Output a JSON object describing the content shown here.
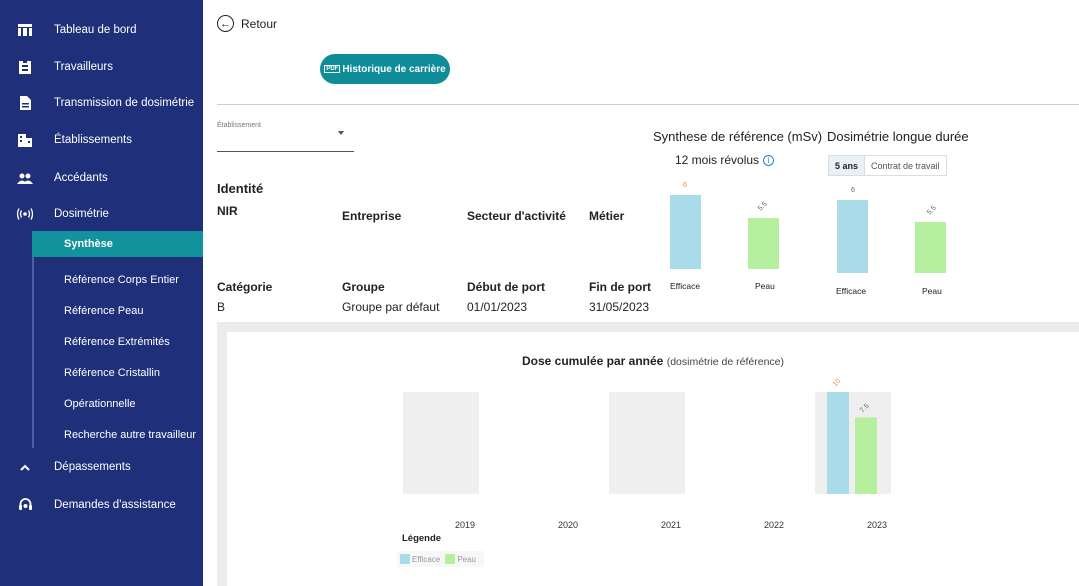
{
  "sidebar": {
    "items": [
      {
        "label": "Tableau de bord",
        "icon": "dashboard-icon"
      },
      {
        "label": "Travailleurs",
        "icon": "badge-icon"
      },
      {
        "label": "Transmission de dosimétrie",
        "icon": "document-icon"
      },
      {
        "label": "Établissements",
        "icon": "building-icon"
      },
      {
        "label": "Accédants",
        "icon": "people-icon"
      },
      {
        "label": "Dosimétrie",
        "icon": "radiation-icon"
      },
      {
        "label": "Dépassements",
        "icon": "chevron-up-icon"
      },
      {
        "label": "Demandes d'assistance",
        "icon": "support-icon"
      }
    ],
    "subitems": [
      {
        "label": "Synthèse",
        "active": true
      },
      {
        "label": "Référence Corps Entier"
      },
      {
        "label": "Référence Peau"
      },
      {
        "label": "Référence Extrémités"
      },
      {
        "label": "Référence Cristallin"
      },
      {
        "label": "Opérationnelle"
      },
      {
        "label": "Recherche autre travailleur"
      }
    ]
  },
  "header": {
    "back_label": "Retour",
    "history_button": "Historique de carrière",
    "pdf_badge": "PDF"
  },
  "establishment_select": {
    "placeholder": "Établissement"
  },
  "identity": {
    "title": "Identité",
    "row1_labels": [
      "NIR",
      "Entreprise",
      "Secteur d'activité",
      "Métier"
    ],
    "row2_labels": [
      "Catégorie",
      "Groupe",
      "Début de port",
      "Fin de port"
    ],
    "row2_values": [
      "B",
      "Groupe par défaut",
      "01/01/2023",
      "31/05/2023"
    ]
  },
  "reference_synthesis": {
    "title": "Synthese de référence (mSv)",
    "subtitle": "12 mois révolus",
    "bars": [
      {
        "label": "Efficace",
        "value_label": "6",
        "value": 6,
        "color": "#a9dce8"
      },
      {
        "label": "Peau",
        "value_label": "5.5",
        "value": 5.5,
        "color": "#b6ef9e"
      }
    ]
  },
  "long_term": {
    "title": "Dosimétrie longue durée",
    "toggle": [
      "5 ans",
      "Contrat de travail"
    ],
    "toggle_active": "5 ans",
    "bars": [
      {
        "label": "Efficace",
        "value_label": "6",
        "value": 6,
        "color": "#a9dce8"
      },
      {
        "label": "Peau",
        "value_label": "5.5",
        "value": 5.5,
        "color": "#b6ef9e"
      }
    ]
  },
  "cumulative_chart": {
    "title": "Dose cumulée par année",
    "subtitle": "(dosimétrie de référence)",
    "legend_title": "Légende",
    "legend": [
      {
        "name": "Efficace",
        "color": "#a9dce8"
      },
      {
        "name": "Peau",
        "color": "#b6ef9e"
      }
    ]
  },
  "chart_data": {
    "type": "bar",
    "title": "Dose cumulée par année",
    "subtitle": "(dosimétrie de référence)",
    "categories": [
      "2019",
      "2020",
      "2021",
      "2022",
      "2023"
    ],
    "series": [
      {
        "name": "Efficace",
        "values": [
          null,
          null,
          null,
          null,
          10
        ],
        "value_labels": [
          "",
          "",
          "",
          "",
          "10"
        ],
        "color": "#a9dce8"
      },
      {
        "name": "Peau",
        "values": [
          null,
          null,
          null,
          null,
          7.5
        ],
        "value_labels": [
          "",
          "",
          "",
          "",
          "7.5"
        ],
        "color": "#b6ef9e"
      }
    ],
    "ylim": [
      0,
      10
    ],
    "grid": false,
    "legend_position": "bottom-left",
    "background_columns_color": "#efefef"
  }
}
